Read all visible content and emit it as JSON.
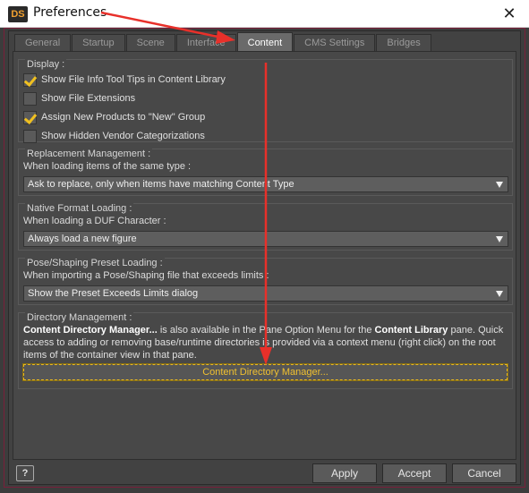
{
  "window": {
    "app_logo": "DS",
    "title": "Preferences",
    "close_glyph": "✕"
  },
  "tabs": [
    {
      "label": "General",
      "active": false
    },
    {
      "label": "Startup",
      "active": false
    },
    {
      "label": "Scene",
      "active": false
    },
    {
      "label": "Interface",
      "active": false
    },
    {
      "label": "Content",
      "active": true
    },
    {
      "label": "CMS Settings",
      "active": false
    },
    {
      "label": "Bridges",
      "active": false
    }
  ],
  "display": {
    "title": "Display :",
    "options": [
      {
        "label": "Show File Info Tool Tips in Content Library",
        "checked": true
      },
      {
        "label": "Show File Extensions",
        "checked": false
      },
      {
        "label": "Assign New Products to \"New\" Group",
        "checked": true
      },
      {
        "label": "Show Hidden Vendor Categorizations",
        "checked": false
      }
    ]
  },
  "replacement": {
    "title": "Replacement Management :",
    "field_label": "When loading items of the same type :",
    "selected": "Ask to replace, only when items have matching Content Type"
  },
  "native_format": {
    "title": "Native Format Loading :",
    "field_label": "When loading a DUF Character :",
    "selected": "Always load a new figure"
  },
  "pose_preset": {
    "title": "Pose/Shaping Preset Loading :",
    "field_label": "When importing a Pose/Shaping file that exceeds limits :",
    "selected": "Show the Preset Exceeds Limits dialog"
  },
  "directory": {
    "title": "Directory Management :",
    "text_bold_1": "Content Directory Manager...",
    "text_1": " is also available in the Pane Option Menu for the ",
    "text_bold_2": "Content Library",
    "text_2": " pane. Quick access to adding or removing base/runtime directories is provided via a context menu (right click) on the root items of the container view in that pane.",
    "button_label": "Content Directory Manager..."
  },
  "footer": {
    "help_label": "?",
    "apply_label": "Apply",
    "accept_label": "Accept",
    "cancel_label": "Cancel"
  },
  "colors": {
    "annotation": "#e8302a",
    "check_accent": "#f0c020"
  }
}
